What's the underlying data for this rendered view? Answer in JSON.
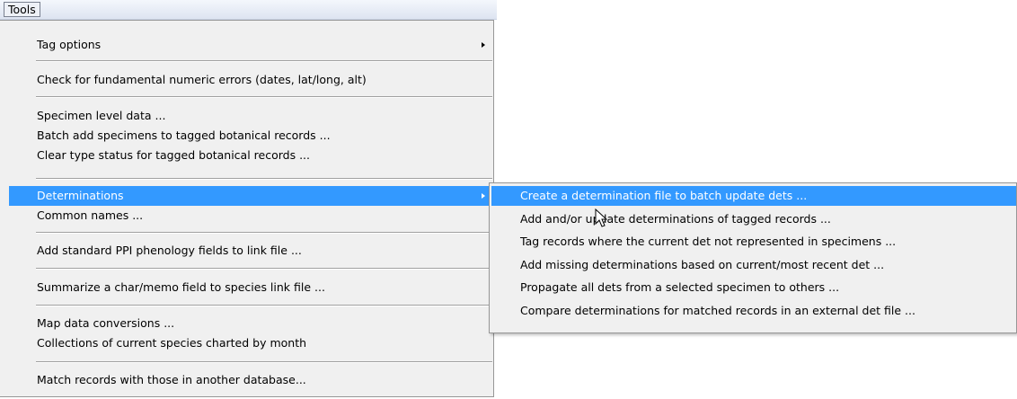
{
  "menubar": {
    "tools_label": "Tools"
  },
  "menu": {
    "items": [
      {
        "label": "Tag options",
        "has_submenu": true
      },
      {
        "label": "Check for fundamental numeric errors (dates, lat/long, alt)"
      },
      {
        "label": "Specimen level data ..."
      },
      {
        "label": "Batch add specimens to tagged botanical records ..."
      },
      {
        "label": "Clear type status for tagged botanical records ..."
      },
      {
        "label": "Determinations",
        "has_submenu": true,
        "highlighted": true
      },
      {
        "label": "Common names ..."
      },
      {
        "label": "Add standard PPI phenology fields to link file ..."
      },
      {
        "label": "Summarize a char/memo field to species link file ..."
      },
      {
        "label": "Map data conversions ..."
      },
      {
        "label": "Collections of current species charted by month"
      },
      {
        "label": "Match records with those in another database..."
      }
    ]
  },
  "submenu": {
    "items": [
      {
        "label": "Create a determination file to batch update dets ...",
        "highlighted": true
      },
      {
        "label": "Add and/or update determinations of tagged records ..."
      },
      {
        "label": "Tag records where the current det not represented in specimens ..."
      },
      {
        "label": "Add missing determinations based on current/most recent det ..."
      },
      {
        "label": "Propagate all dets from a selected specimen to others ..."
      },
      {
        "label": "Compare determinations for matched records in an external det file ..."
      }
    ]
  },
  "colors": {
    "highlight": "#3399ff",
    "menu_bg": "#f0f0f0",
    "highlight_text": "#ffffff"
  },
  "icons": {
    "submenu_arrow": "arrow-right-icon",
    "cursor": "mouse-pointer-icon"
  }
}
